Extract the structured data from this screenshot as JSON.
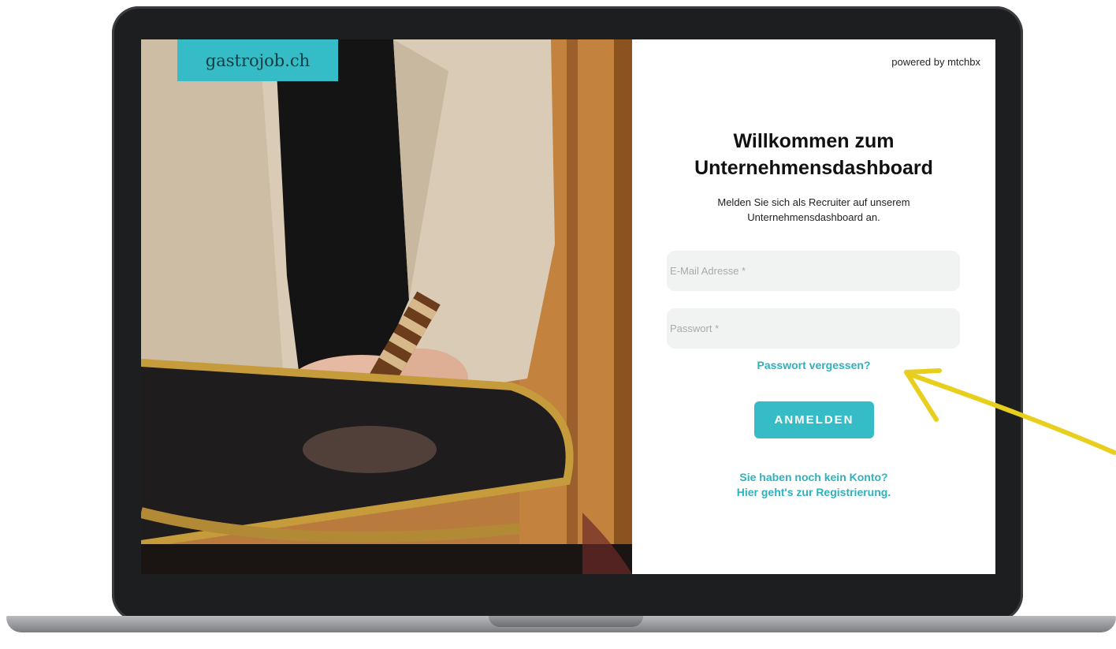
{
  "brand": {
    "logo_text": "gastrojob.ch",
    "color": "#35bcc6"
  },
  "header": {
    "powered_by": "powered by mtchbx"
  },
  "login": {
    "title_line1": "Willkommen zum",
    "title_line2": "Unternehmensdashboard",
    "subtitle_line1": "Melden Sie sich als Recruiter auf unserem",
    "subtitle_line2": "Unternehmensdashboard an.",
    "email_placeholder": "E-Mail Adresse *",
    "password_placeholder": "Passwort *",
    "forgot_password": "Passwort vergessen?",
    "submit_label": "ANMELDEN",
    "register_line1": "Sie haben noch kein Konto?",
    "register_line2": "Hier geht's zur Registrierung."
  },
  "colors": {
    "accent": "#35bcc6",
    "link": "#2fb2bd",
    "annotation_arrow": "#e8cf1e"
  },
  "icons": {
    "annotation": "hand-drawn-arrow-icon"
  }
}
